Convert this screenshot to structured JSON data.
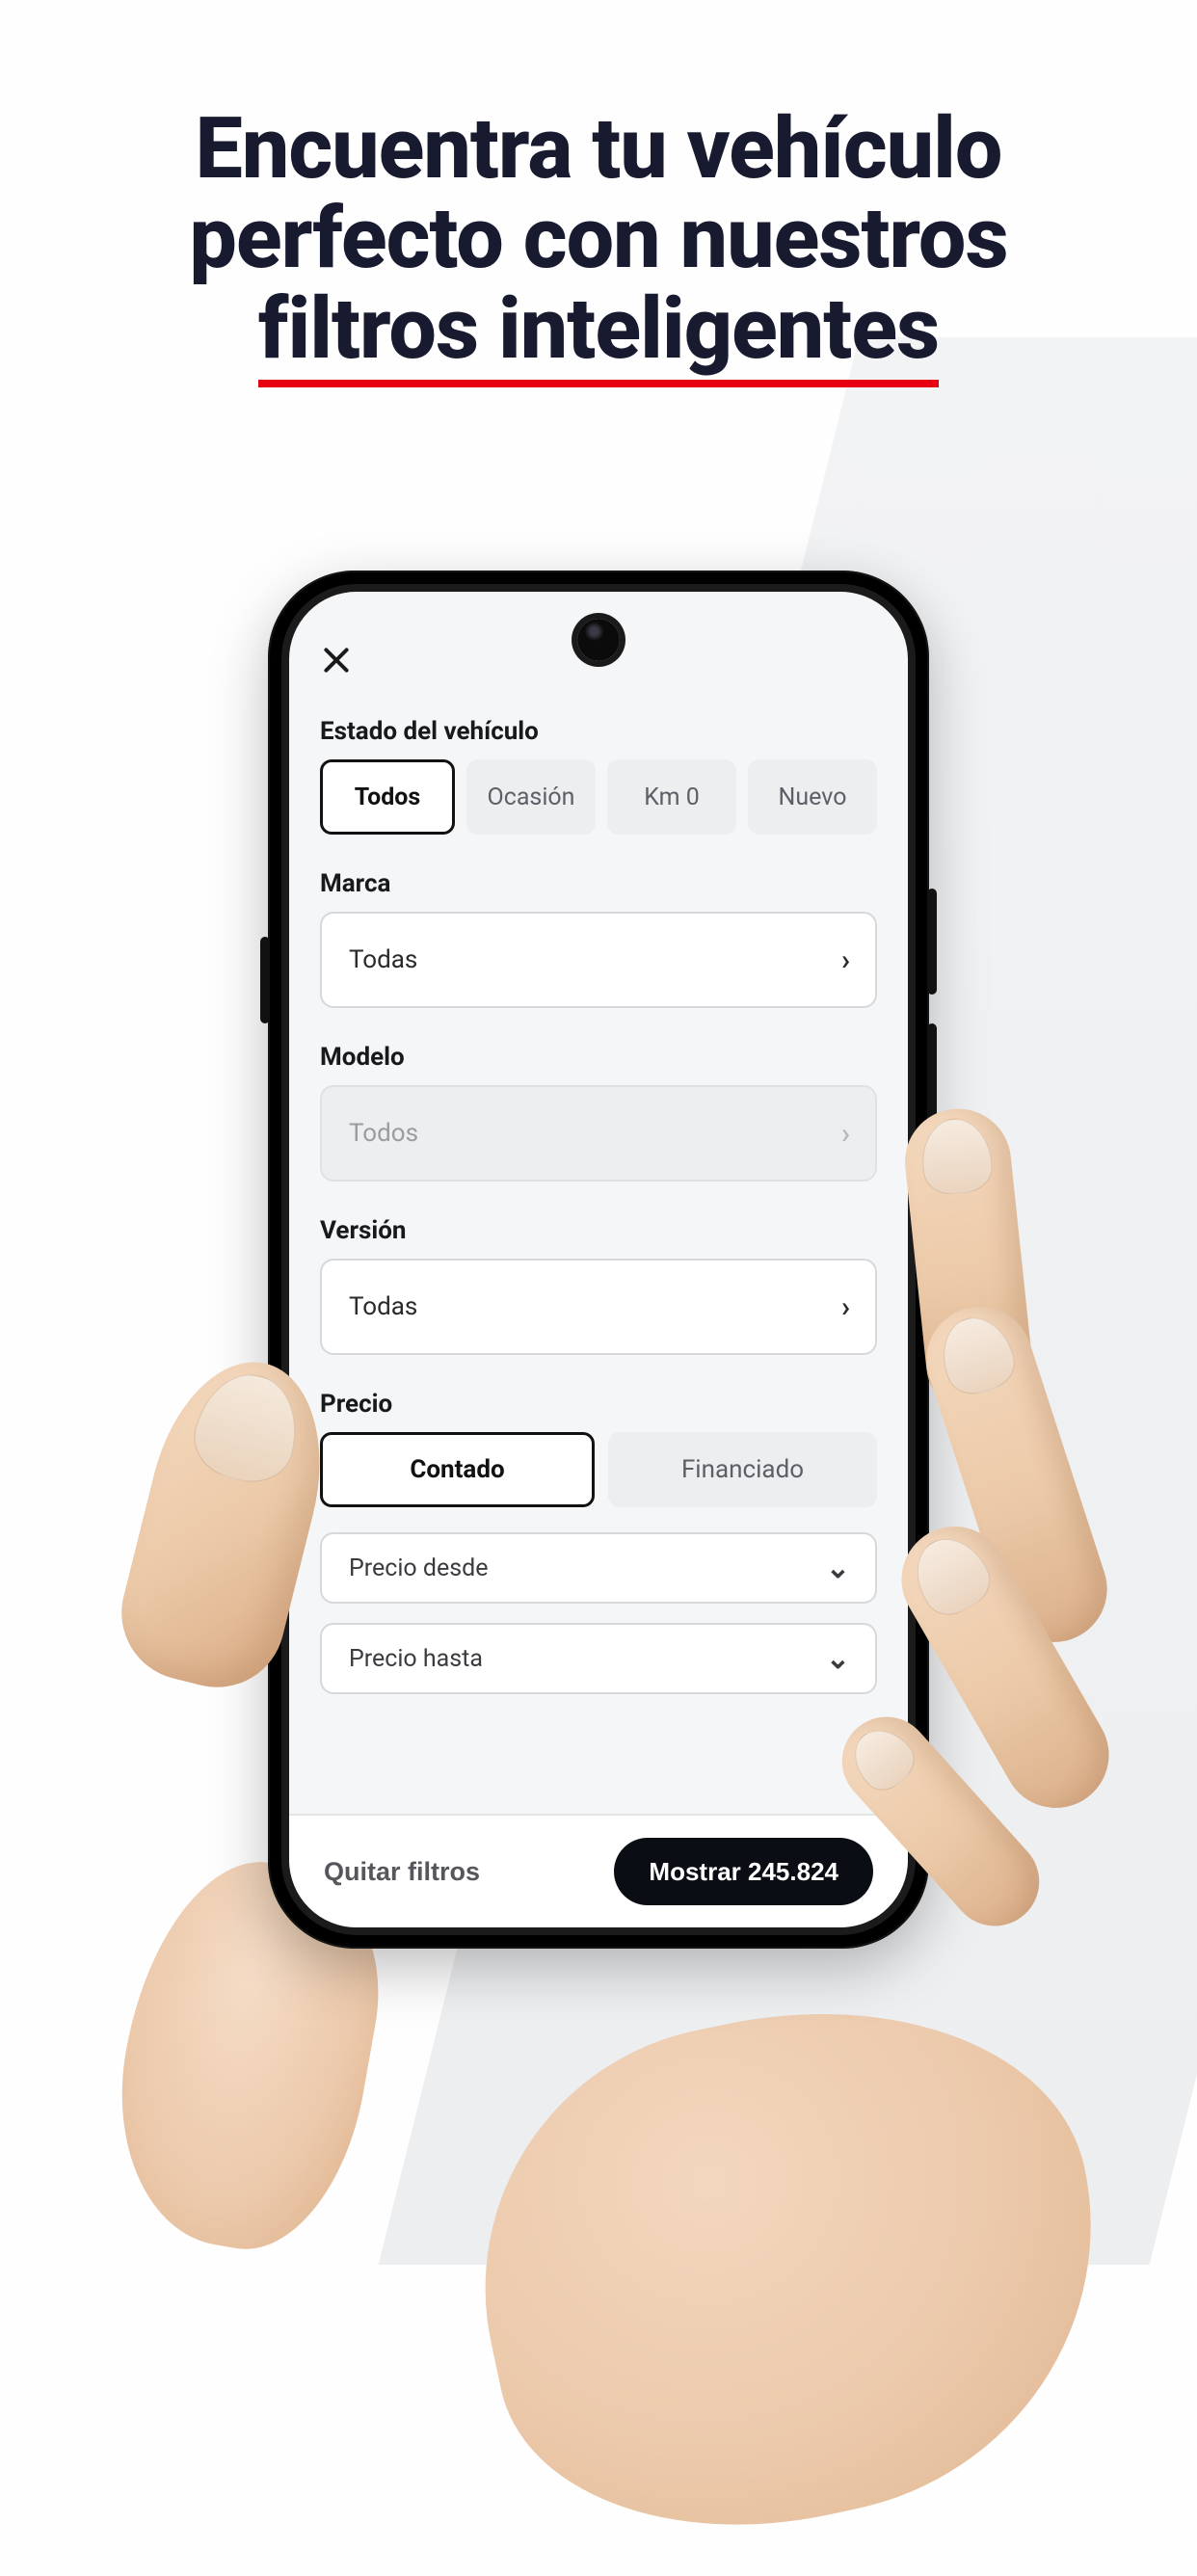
{
  "hero": {
    "line1": "Encuentra tu vehículo",
    "line2": "perfecto con nuestros",
    "line3": "filtros inteligentes"
  },
  "filters": {
    "state": {
      "label": "Estado del vehículo",
      "options": [
        "Todos",
        "Ocasión",
        "Km 0",
        "Nuevo"
      ],
      "selected": "Todos"
    },
    "brand": {
      "label": "Marca",
      "value": "Todas"
    },
    "model": {
      "label": "Modelo",
      "value": "Todos"
    },
    "version": {
      "label": "Versión",
      "value": "Todas"
    },
    "price": {
      "label": "Precio",
      "modes": [
        "Contado",
        "Financiado"
      ],
      "selected": "Contado",
      "from_label": "Precio desde",
      "to_label": "Precio hasta"
    }
  },
  "footer": {
    "clear": "Quitar filtros",
    "show_prefix": "Mostrar",
    "count": "245.824"
  }
}
